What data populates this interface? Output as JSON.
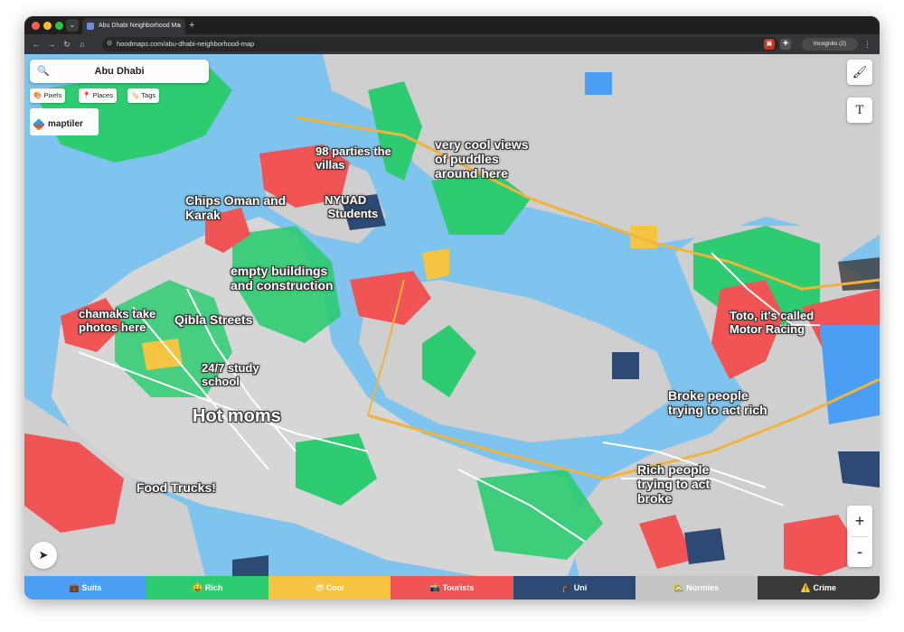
{
  "browser": {
    "tab_title": "Abu Dhabi Neighborhood Ma",
    "tab_close": "×",
    "new_tab": "+",
    "url": "hoodmaps.com/abu-dhabi-neighborhood-map",
    "profile": "Incognito (2)"
  },
  "search": {
    "city": "Abu Dhabi"
  },
  "layers": [
    {
      "icon": "🎨",
      "label": "Pixels"
    },
    {
      "icon": "📍",
      "label": "Places"
    },
    {
      "icon": "🏷️",
      "label": "Tags"
    }
  ],
  "attribution": {
    "maptiler": "maptiler"
  },
  "map": {
    "labels": [
      {
        "text": "98 parties the\nvillas",
        "size": "normal"
      },
      {
        "text": "very cool views\nof puddles\naround here",
        "size": "mid"
      },
      {
        "text": "Chips Oman and\nKarak",
        "size": "mid"
      },
      {
        "text": "NYUAD\nStudents",
        "size": "normal"
      },
      {
        "text": "empty buildings\nand construction",
        "size": "mid"
      },
      {
        "text": "chamaks take\nphotos here",
        "size": "normal"
      },
      {
        "text": "Qibla Streets",
        "size": "mid"
      },
      {
        "text": "24/7 study\nschool",
        "size": "normal"
      },
      {
        "text": "Hot moms",
        "size": "big"
      },
      {
        "text": "Food Trucks!",
        "size": "mid"
      },
      {
        "text": "Toto, it's called\nMotor Racing",
        "size": "normal"
      },
      {
        "text": "Broke people\ntrying to act rich",
        "size": "mid"
      },
      {
        "text": "Rich people\ntrying to act\nbroke",
        "size": "mid"
      }
    ]
  },
  "zoom": {
    "in": "+",
    "out": "-"
  },
  "legend": [
    {
      "icon": "💼",
      "label": "Suits",
      "color": "#4a9ff5"
    },
    {
      "icon": "🤑",
      "label": "Rich",
      "color": "#2ecc71"
    },
    {
      "icon": "😎",
      "label": "Cool",
      "color": "#f5c542"
    },
    {
      "icon": "📸",
      "label": "Tourists",
      "color": "#f05454"
    },
    {
      "icon": "🎓",
      "label": "Uni",
      "color": "#2c4a73"
    },
    {
      "icon": "🏡",
      "label": "Normies",
      "color": "#c4c4c4"
    },
    {
      "icon": "⚠️",
      "label": "Crime",
      "color": "#3a3a3a"
    }
  ]
}
